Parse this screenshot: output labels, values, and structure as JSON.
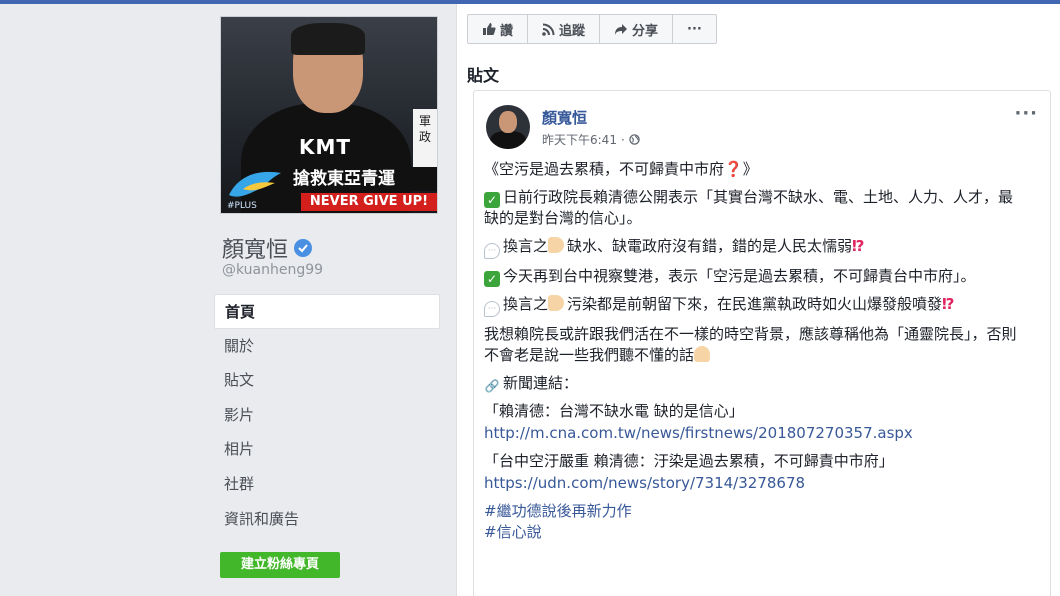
{
  "cover": {
    "kmt": "KMT",
    "sign": "軍 政",
    "banner_text": "搶救東亞青運",
    "banner_slogan": "NEVER GIVE UP!",
    "logo_text": "#PLUS"
  },
  "page": {
    "name": "顏寬恒",
    "username": "@kuanheng99"
  },
  "nav": {
    "items": [
      {
        "label": "首頁",
        "active": true
      },
      {
        "label": "關於"
      },
      {
        "label": "貼文"
      },
      {
        "label": "影片"
      },
      {
        "label": "相片"
      },
      {
        "label": "社群"
      },
      {
        "label": "資訊和廣告"
      }
    ]
  },
  "create_button": "建立粉絲專頁",
  "actions": {
    "like": "讚",
    "follow": "追蹤",
    "share": "分享",
    "more": "···"
  },
  "posts_title": "貼文",
  "post": {
    "author": "顏寬恒",
    "time": "昨天下午6:41",
    "more": "···",
    "title": "《空污是過去累積，不可歸責中市府",
    "title_end": "》",
    "p1": "日前行政院長賴清德公開表示「其實台灣不缺水、電、土地、人力、人才，最缺的是對台灣的信心」。",
    "p2": "換言之",
    "p2b": "缺水、缺電政府沒有錯，錯的是人民太懦弱",
    "p3": "今天再到台中視察雙港，表示「空污是過去累積，不可歸責台中市府」。",
    "p4": "換言之",
    "p4b": "污染都是前朝留下來，在民進黨執政時如火山爆發般噴發",
    "p5": "我想賴院長或許跟我們活在不一樣的時空背景，應該尊稱他為「通靈院長」，否則不會老是說一些我們聽不懂的話",
    "p6": "新聞連結：",
    "news1_title": "「賴清德：台灣不缺水電 缺的是信心」",
    "news1_url": "http://m.cna.com.tw/news/firstnews/201807270357.aspx",
    "news2_title": "「台中空汙嚴重 賴清德：汙染是過去累積，不可歸責中市府」",
    "news2_url": "https://udn.com/news/story/7314/3278678",
    "tag1": "#繼功德說後再新力作",
    "tag2": "#信心說"
  }
}
